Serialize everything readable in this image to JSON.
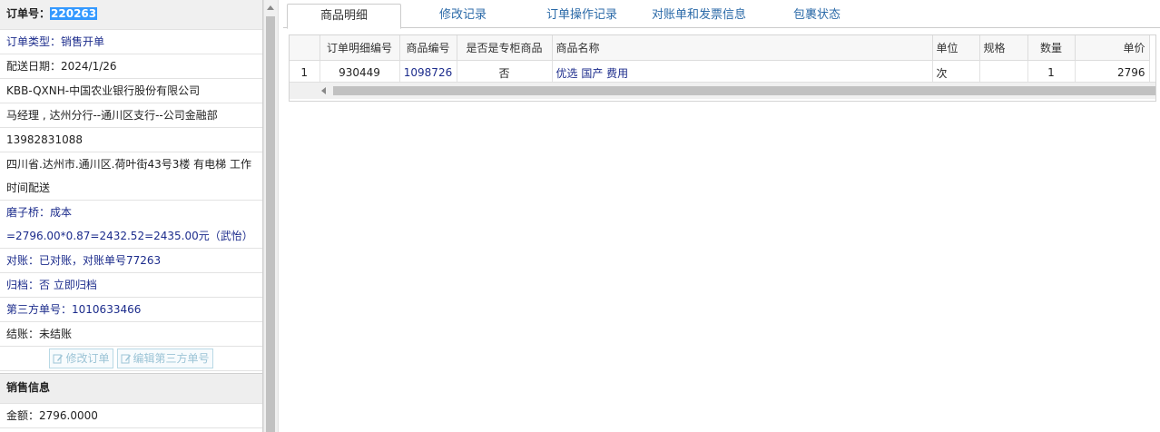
{
  "order": {
    "number_label": "订单号：",
    "number_value": "220263",
    "type_label": "订单类型：",
    "type_value": "销售开单",
    "delivery_date": "配送日期：2024/1/26",
    "company": "KBB-QXNH-中国农业银行股份有限公司",
    "contact": "马经理 , 达州分行--通川区支行--公司金融部",
    "phone": "13982831088",
    "address": "四川省.达州市.通川区.荷叶街43号3楼 有电梯 工作时间配送",
    "mozi_label": "磨子桥：",
    "mozi_value": "成本=2796.00*0.87=2432.52=2435.00元（武怡）",
    "reconcile_label": "对账：",
    "reconcile_value": "已对账，对账单号77263",
    "archive_label": "归档：",
    "archive_value": "否 立即归档",
    "third_party_label": "第三方单号：",
    "third_party_value": "1010633466",
    "settle_label": "结账：",
    "settle_value": "未结账"
  },
  "buttons": {
    "edit_order": "修改订单",
    "edit_third_party": "编辑第三方单号"
  },
  "sales": {
    "section_title": "销售信息",
    "amount": "金额：2796.0000"
  },
  "tabs": [
    {
      "label": "商品明细"
    },
    {
      "label": "修改记录"
    },
    {
      "label": "订单操作记录"
    },
    {
      "label": "对账单和发票信息"
    },
    {
      "label": "包裹状态"
    }
  ],
  "table": {
    "headers": [
      "订单明细编号",
      "商品编号",
      "是否是专柜商品",
      "商品名称",
      "单位",
      "规格",
      "数量",
      "单价"
    ],
    "rows": [
      {
        "index": "1",
        "detail_id": "930449",
        "product_id": "1098726",
        "counter": "否",
        "name": "优选 国产 费用",
        "unit": "次",
        "spec": "",
        "qty": "1",
        "price": "2796"
      }
    ]
  },
  "colors": {
    "accent_blue": "#1c2c8c",
    "tab_link": "#2b6aa8",
    "selection": "#3399ff"
  }
}
